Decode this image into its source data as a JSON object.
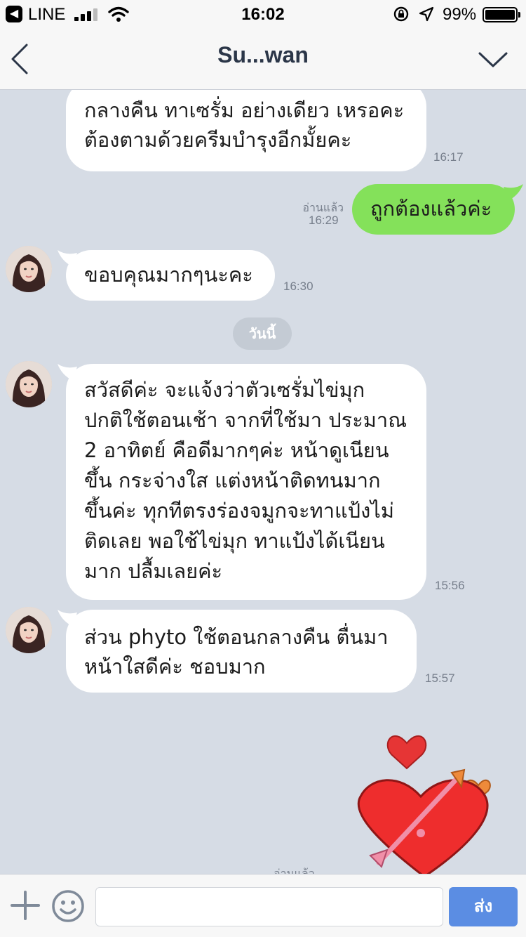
{
  "status_bar": {
    "app_name": "LINE",
    "time": "16:02",
    "battery_percent": "99%",
    "battery_level": 0.99
  },
  "header": {
    "title": "Su...wan"
  },
  "messages": [
    {
      "direction": "in",
      "text": "กลางคืน ทาเซรั่ม อย่างเดียว เหรอคะ ต้องตามด้วยครีมบำรุงอีกมั้ยคะ",
      "time": "16:17"
    },
    {
      "direction": "out",
      "text": "ถูกต้องแล้วค่ะ",
      "read": "อ่านแล้ว",
      "time": "16:29"
    },
    {
      "direction": "in",
      "text": "ขอบคุณมากๆนะคะ",
      "time": "16:30"
    },
    {
      "direction": "in",
      "text": "สวัสดีค่ะ จะแจ้งว่าตัวเซรั่มไข่มุก ปกติใช้ตอนเช้า จากที่ใช้มา ประมาณ 2 อาทิตย์ คือดีมากๆค่ะ หน้าดูเนียนขึ้น กระจ่างใส แต่งหน้าติดทนมากขึ้นค่ะ ทุกทีตรงร่องจมูกจะทาแป้งไม่ติดเลย พอใช้ไข่มุก ทาแป้งได้เนียนมาก ปลื้มเลยค่ะ",
      "time": "15:56"
    },
    {
      "direction": "in",
      "text": "ส่วน phyto ใช้ตอนกลางคืน ตื่นมาหน้าใสดีค่ะ ชอบมาก",
      "time": "15:57"
    }
  ],
  "date_divider": "วันนี้",
  "sticker_read_cut": "อ่านแล้ว",
  "input": {
    "placeholder": "",
    "value": "",
    "send_label": "ส่ง"
  },
  "colors": {
    "chat_background": "#d6dce5",
    "outgoing_bubble": "#84e15a",
    "send_button": "#5b8de3"
  }
}
